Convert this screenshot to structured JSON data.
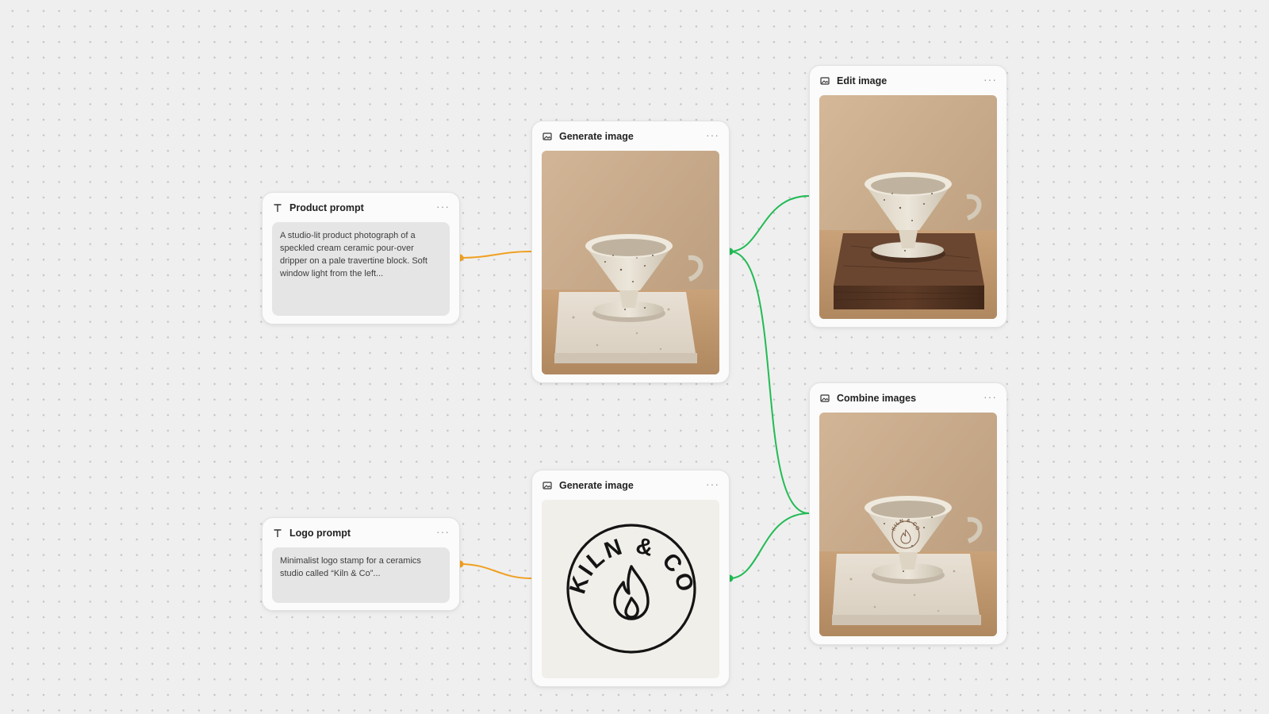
{
  "nodes": {
    "product_prompt": {
      "title": "Product prompt",
      "icon": "text-icon",
      "text": "A studio-lit product photograph of a speckled cream ceramic pour-over dripper on a pale travertine block. Soft window light from the left..."
    },
    "logo_prompt": {
      "title": "Logo prompt",
      "icon": "text-icon",
      "text": "Minimalist logo stamp for a ceramics studio called “Kiln & Co”..."
    },
    "generate_image_1": {
      "title": "Generate image",
      "icon": "image-icon",
      "image": "speckled cream ceramic pour-over dripper on travertine block"
    },
    "generate_image_2": {
      "title": "Generate image",
      "icon": "image-icon",
      "image": "circular logo stamp with flame",
      "logo_text": "KILN & CO"
    },
    "edit_image": {
      "title": "Edit image",
      "icon": "image-icon",
      "image": "ceramic dripper on dark walnut block"
    },
    "combine_images": {
      "title": "Combine images",
      "icon": "image-icon",
      "image": "ceramic dripper with stamped logo on travertine block",
      "stamp_text": "KILN & CO"
    }
  },
  "more_glyph": "···",
  "colors": {
    "canvas_bg": "#efefef",
    "text_wire": "#f0a020",
    "image_wire": "#22bb55",
    "node_bg": "#fbfbfb",
    "prompt_bg": "#e5e5e5"
  }
}
